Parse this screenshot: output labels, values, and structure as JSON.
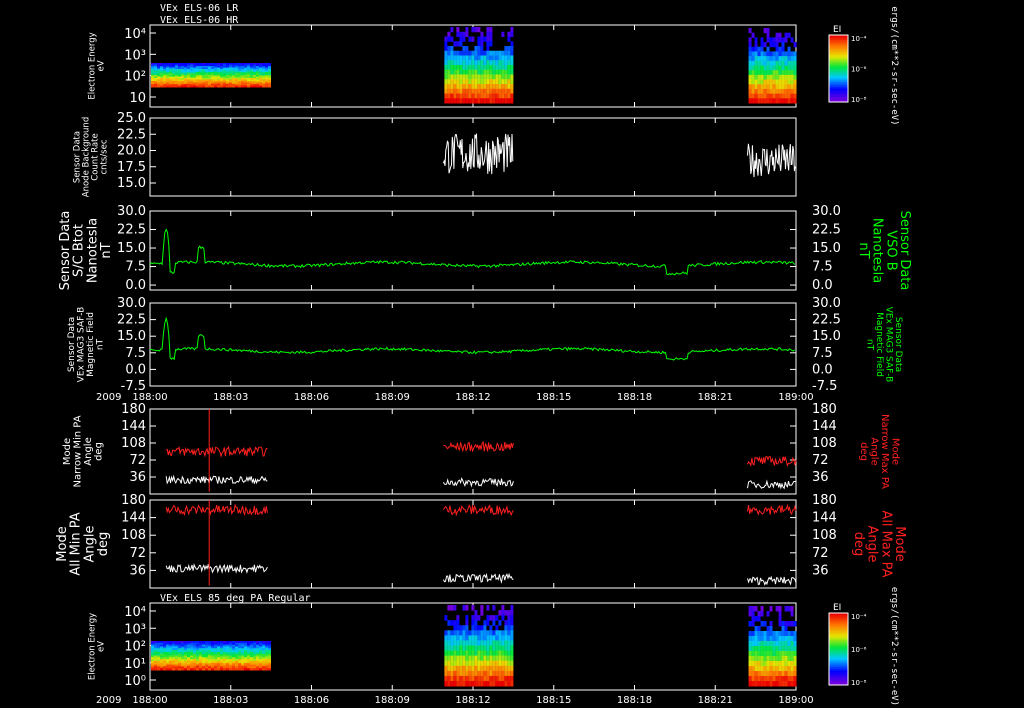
{
  "header": {
    "line1": "VEx ELS-06 LR",
    "line2": "VEx ELS-06 HR"
  },
  "time_axis": {
    "year": "2009",
    "ticks": [
      "188:00",
      "188:03",
      "188:06",
      "188:09",
      "188:12",
      "188:15",
      "188:18",
      "188:21",
      "189:00"
    ],
    "range_hours": [
      0,
      24
    ]
  },
  "chart_data": [
    {
      "id": "spectrogram-top",
      "type": "heatmap",
      "title": "",
      "ylabel_lines": [
        "Electron Energy",
        "eV"
      ],
      "yticks": [
        "10⁴",
        "10³",
        "10²",
        "10"
      ],
      "colorbar": {
        "title": "EI",
        "ticks": [
          "10⁻⁴",
          "10⁻⁶",
          "10⁻⁸"
        ],
        "unit": "ergs/(cm**2-sr-sec-eV)"
      },
      "data_intervals_hours": [
        [
          0.0,
          4.4
        ],
        [
          10.9,
          13.5
        ],
        [
          22.2,
          24.0
        ]
      ]
    },
    {
      "id": "background-counts",
      "type": "line",
      "ylabel_lines": [
        "Sensor Data",
        "Anode Background",
        "Count Rate",
        "cnts/sec"
      ],
      "yticks": [
        "25.0",
        "22.5",
        "20.0",
        "17.5",
        "15.0"
      ],
      "ylim": [
        13.0,
        25.0
      ],
      "series": [
        {
          "color": "#ffffff",
          "x_range": [
            10.9,
            13.5
          ],
          "baseline": 19.5,
          "amplitude": 3.2
        },
        {
          "color": "#ffffff",
          "x_range": [
            22.2,
            24.0
          ],
          "baseline": 18.5,
          "amplitude": 2.6
        }
      ]
    },
    {
      "id": "btot",
      "type": "line",
      "ylabel_lines": [
        "Sensor Data",
        "S/C Btot",
        "Nanotesla",
        "nT"
      ],
      "right_label_lines": [
        "Sensor Data",
        "VSO B",
        "Nanotesla",
        "nT"
      ],
      "yticks": [
        "30.0",
        "22.5",
        "15.0",
        "7.5",
        "0.0"
      ],
      "ylim": [
        -2.0,
        30.0
      ],
      "series": [
        {
          "color": "#00ff00",
          "baseline": 8.5
        }
      ]
    },
    {
      "id": "mag-saf-b",
      "type": "line",
      "ylabel_lines": [
        "Sensor Data",
        "VEx MAG3 SAF-B",
        "Magnetic Field",
        "nT"
      ],
      "right_label_lines": [
        "Sensor Data",
        "VEx MAG3 SAF-B",
        "Magnetic Field",
        "nT"
      ],
      "yticks": [
        "30.0",
        "22.5",
        "15.0",
        "7.5",
        "0.0",
        "-7.5"
      ],
      "ylim": [
        -7.5,
        30.0
      ],
      "series": [
        {
          "color": "#00ff00",
          "baseline": 8.5
        }
      ]
    },
    {
      "id": "narrow-pa",
      "type": "line",
      "ylabel_lines": [
        "Mode",
        "Narrow Min PA",
        "Angle",
        "deg"
      ],
      "right_label_lines": [
        "Mode",
        "Narrow Max PA",
        "Angle",
        "deg"
      ],
      "yticks": [
        "180",
        "144",
        "108",
        "72",
        "36"
      ],
      "ylim": [
        0,
        180
      ],
      "series": [
        {
          "name_side": "min",
          "color": "#ffffff"
        },
        {
          "name_side": "max",
          "color": "#ff2020"
        }
      ]
    },
    {
      "id": "all-pa",
      "type": "line",
      "ylabel_lines": [
        "Mode",
        "All Min PA",
        "Angle",
        "deg"
      ],
      "right_label_lines": [
        "Mode",
        "All Max PA",
        "Angle",
        "deg"
      ],
      "yticks": [
        "180",
        "144",
        "108",
        "72",
        "36"
      ],
      "ylim": [
        0,
        180
      ],
      "series": [
        {
          "name_side": "min",
          "color": "#ffffff"
        },
        {
          "name_side": "max",
          "color": "#ff2020"
        }
      ]
    },
    {
      "id": "spectrogram-bottom",
      "type": "heatmap",
      "title": "VEx ELS 85 deg PA Regular",
      "ylabel_lines": [
        "Electron Energy",
        "eV"
      ],
      "yticks": [
        "10⁴",
        "10³",
        "10²",
        "10¹",
        "10⁰"
      ],
      "colorbar": {
        "title": "EI",
        "ticks": [
          "10⁻⁴",
          "10⁻⁶",
          "10⁻⁸"
        ],
        "unit": "ergs/(cm**2-sr-sec-eV)"
      },
      "data_intervals_hours": [
        [
          0.0,
          4.4
        ],
        [
          10.9,
          13.5
        ],
        [
          22.2,
          24.0
        ]
      ]
    }
  ]
}
